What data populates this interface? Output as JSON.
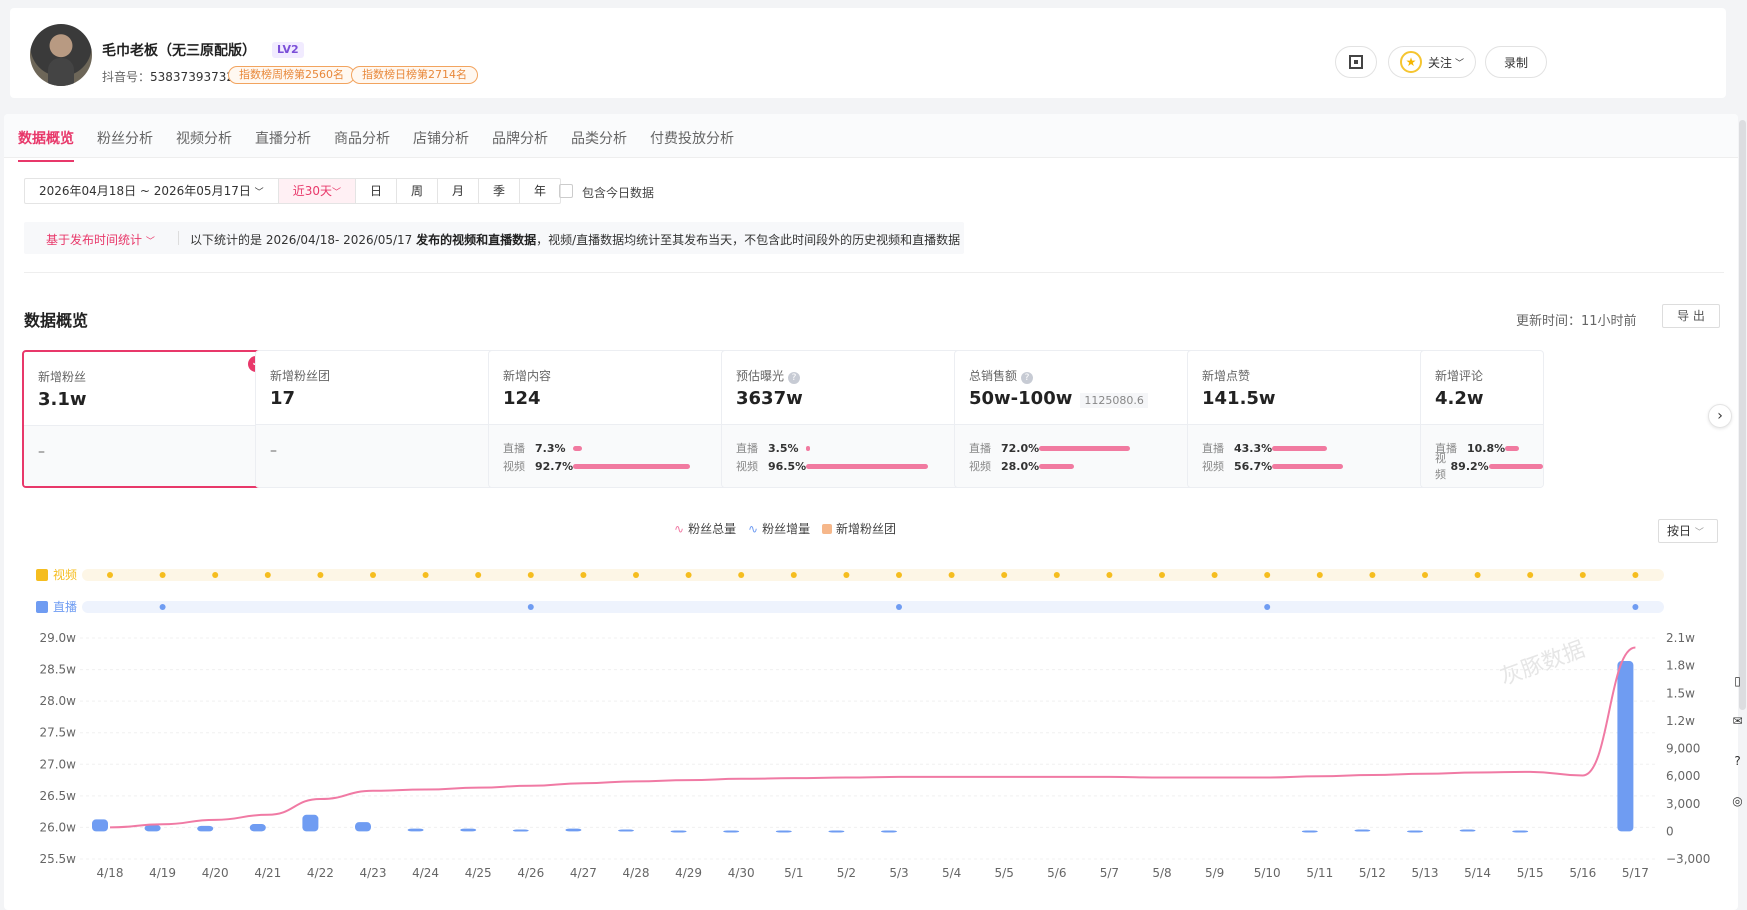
{
  "header": {
    "name": "毛巾老板（无三原配版）",
    "level": "LV2",
    "douyin_label": "抖音号：",
    "douyin_id": "53837393732",
    "rank_week": "指数榜周榜第2560名",
    "rank_day": "指数榜日榜第2714名",
    "follow_label": "关注",
    "record_label": "录制"
  },
  "tabs": [
    "数据概览",
    "粉丝分析",
    "视频分析",
    "直播分析",
    "商品分析",
    "店铺分析",
    "品牌分析",
    "品类分析",
    "付费投放分析"
  ],
  "filters": {
    "date_range": "2026年04月18日 ~ 2026年05月17日",
    "quick": "近30天",
    "periods": [
      "日",
      "周",
      "月",
      "季",
      "年"
    ],
    "include_today": "包含今日数据",
    "basis": "基于发布时间统计",
    "desc_prefix": "以下统计的是 2026/04/18- 2026/05/17 ",
    "desc_bold": "发布的视频和直播数据",
    "desc_suffix": "，视频/直播数据均统计至其发布当天，不包含此时间段外的历史视频和直播数据"
  },
  "overview": {
    "title": "数据概览",
    "update": "更新时间：11小时前",
    "export": "导 出"
  },
  "cards": [
    {
      "label": "新增粉丝",
      "value": "3.1w",
      "selected": true,
      "dash": "–"
    },
    {
      "label": "新增粉丝团",
      "value": "17",
      "dash": "–"
    },
    {
      "label": "新增内容",
      "value": "124",
      "live": "7.3%",
      "video": "92.7%",
      "live_pct": 7.3,
      "video_pct": 92.7
    },
    {
      "label": "预估曝光",
      "value": "3637w",
      "help": true,
      "live": "3.5%",
      "video": "96.5%",
      "live_pct": 3.5,
      "video_pct": 96.5
    },
    {
      "label": "总销售额",
      "value": "50w-100w",
      "help": true,
      "sub": "1125080.6",
      "live": "72.0%",
      "video": "28.0%",
      "live_pct": 72.0,
      "video_pct": 28.0
    },
    {
      "label": "新增点赞",
      "value": "141.5w",
      "live": "43.3%",
      "video": "56.7%",
      "live_pct": 43.3,
      "video_pct": 56.7
    },
    {
      "label": "新增评论",
      "value": "4.2w",
      "live": "10.8%",
      "video": "89.2%",
      "live_pct": 10.8,
      "video_pct": 89.2
    }
  ],
  "labels": {
    "live": "直播",
    "video": "视频"
  },
  "legend": [
    "粉丝总量",
    "粉丝增量",
    "新增粉丝团"
  ],
  "granularity": "按日",
  "track_labels": {
    "video": "视频",
    "live": "直播"
  },
  "colors": {
    "accent": "#e8386a",
    "line": "#f07aa4",
    "bar": "#6f9cf2",
    "video_dot": "#f5bd1f",
    "live_dot": "#6f9cf2"
  },
  "chart_data": {
    "type": "line",
    "x": [
      "4/18",
      "4/19",
      "4/20",
      "4/21",
      "4/22",
      "4/23",
      "4/24",
      "4/25",
      "4/26",
      "4/27",
      "4/28",
      "4/29",
      "4/30",
      "5/1",
      "5/2",
      "5/3",
      "5/4",
      "5/5",
      "5/6",
      "5/7",
      "5/8",
      "5/9",
      "5/10",
      "5/11",
      "5/12",
      "5/13",
      "5/14",
      "5/15",
      "5/16",
      "5/17"
    ],
    "series": [
      {
        "name": "粉丝总量",
        "axis": "left",
        "values": [
          260000,
          260500,
          261200,
          262000,
          264500,
          265800,
          266000,
          266300,
          266600,
          267000,
          267300,
          267500,
          267700,
          267800,
          267900,
          268000,
          268000,
          268000,
          268000,
          268000,
          267900,
          267900,
          267900,
          268100,
          268300,
          268500,
          268700,
          268800,
          269500,
          288500
        ]
      },
      {
        "name": "粉丝增量",
        "axis": "right",
        "type": "bar",
        "values": [
          1300,
          700,
          600,
          800,
          1800,
          1000,
          300,
          300,
          200,
          300,
          200,
          100,
          100,
          100,
          100,
          100,
          0,
          0,
          0,
          0,
          0,
          0,
          0,
          100,
          200,
          100,
          200,
          100,
          0,
          18500
        ]
      }
    ],
    "live_days": [
      "4/19",
      "4/26",
      "5/3",
      "5/10",
      "5/17"
    ],
    "yleft_ticks": [
      "29.0w",
      "28.5w",
      "28.0w",
      "27.5w",
      "27.0w",
      "26.5w",
      "26.0w",
      "25.5w"
    ],
    "yright_ticks": [
      "2.1w",
      "1.8w",
      "1.5w",
      "1.2w",
      "9,000",
      "6,000",
      "3,000",
      "0",
      "−3,000"
    ],
    "ylim_left": [
      255000,
      290000
    ],
    "ylim_right": [
      -3000,
      21000
    ],
    "watermark": "灰豚数据"
  }
}
